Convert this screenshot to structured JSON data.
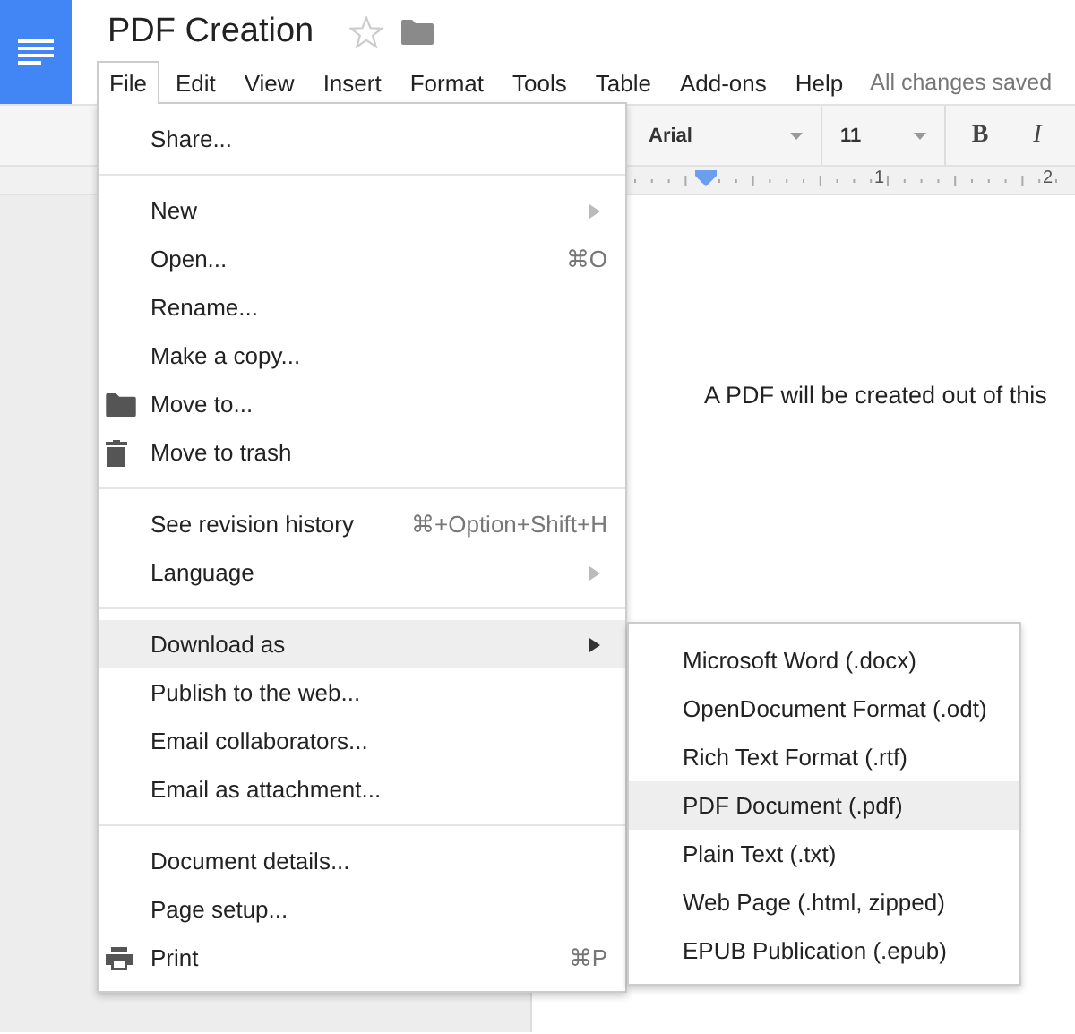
{
  "document": {
    "title": "PDF Creation",
    "starred": false,
    "status": "All changes saved"
  },
  "menubar": [
    {
      "label": "File",
      "selected": true
    },
    {
      "label": "Edit",
      "selected": false
    },
    {
      "label": "View",
      "selected": false
    },
    {
      "label": "Insert",
      "selected": false
    },
    {
      "label": "Format",
      "selected": false
    },
    {
      "label": "Tools",
      "selected": false
    },
    {
      "label": "Table",
      "selected": false
    },
    {
      "label": "Add-ons",
      "selected": false
    },
    {
      "label": "Help",
      "selected": false
    }
  ],
  "toolbar": {
    "font": "Arial",
    "size": "11",
    "buttons": [
      {
        "label": "B",
        "kind": "bold"
      },
      {
        "label": "I",
        "kind": "italic"
      }
    ]
  },
  "ruler": {
    "labels": [
      "1",
      "2"
    ]
  },
  "page": {
    "text": "A PDF will be created out of this"
  },
  "file_menu": {
    "groups": [
      [
        {
          "label": "Share...",
          "kind": "plain",
          "selected": false,
          "submenu": false
        }
      ],
      [
        {
          "label": "New",
          "kind": "plain",
          "selected": false,
          "submenu": true
        },
        {
          "label": "Open...",
          "kind": "plain",
          "shortcut": "⌘O",
          "selected": false,
          "submenu": false
        },
        {
          "label": "Rename...",
          "kind": "plain",
          "selected": false,
          "submenu": false
        },
        {
          "label": "Make a copy...",
          "kind": "plain",
          "selected": false,
          "submenu": false
        },
        {
          "label": "Move to...",
          "kind": "folder",
          "selected": false,
          "submenu": false
        },
        {
          "label": "Move to trash",
          "kind": "trash",
          "selected": false,
          "submenu": false
        }
      ],
      [
        {
          "label": "See revision history",
          "kind": "plain",
          "shortcut": "⌘+Option+Shift+H",
          "selected": false,
          "submenu": false
        },
        {
          "label": "Language",
          "kind": "plain",
          "selected": false,
          "submenu": true
        }
      ],
      [
        {
          "label": "Download as",
          "kind": "plain",
          "selected": true,
          "submenu": true
        },
        {
          "label": "Publish to the web...",
          "kind": "plain",
          "selected": false,
          "submenu": false
        },
        {
          "label": "Email collaborators...",
          "kind": "plain",
          "selected": false,
          "submenu": false
        },
        {
          "label": "Email as attachment...",
          "kind": "plain",
          "selected": false,
          "submenu": false
        }
      ],
      [
        {
          "label": "Document details...",
          "kind": "plain",
          "selected": false,
          "submenu": false
        },
        {
          "label": "Page setup...",
          "kind": "plain",
          "selected": false,
          "submenu": false
        },
        {
          "label": "Print",
          "kind": "printer",
          "shortcut": "⌘P",
          "selected": false,
          "submenu": false
        }
      ]
    ]
  },
  "download_submenu": [
    {
      "label": "Microsoft Word (.docx)",
      "selected": false
    },
    {
      "label": "OpenDocument Format (.odt)",
      "selected": false
    },
    {
      "label": "Rich Text Format (.rtf)",
      "selected": false
    },
    {
      "label": "PDF Document (.pdf)",
      "selected": true
    },
    {
      "label": "Plain Text (.txt)",
      "selected": false
    },
    {
      "label": "Web Page (.html, zipped)",
      "selected": false
    },
    {
      "label": "EPUB Publication (.epub)",
      "selected": false
    }
  ]
}
